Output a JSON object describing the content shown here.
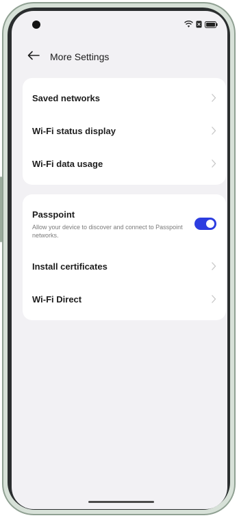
{
  "header": {
    "title": "More Settings",
    "back_icon": "back-arrow-icon"
  },
  "status_bar": {
    "icons": [
      "wifi-icon",
      "sim-icon",
      "battery-icon"
    ]
  },
  "group1": {
    "items": [
      {
        "label": "Saved networks"
      },
      {
        "label": "Wi-Fi status display"
      },
      {
        "label": "Wi-Fi data usage"
      }
    ]
  },
  "group2": {
    "passpoint": {
      "label": "Passpoint",
      "description": "Allow your device to discover and connect to Passpoint networks.",
      "enabled": true
    },
    "items": [
      {
        "label": "Install certificates"
      },
      {
        "label": "Wi-Fi Direct"
      }
    ]
  },
  "colors": {
    "accent": "#2c3de0",
    "background": "#f2f1f4",
    "card": "#ffffff"
  }
}
